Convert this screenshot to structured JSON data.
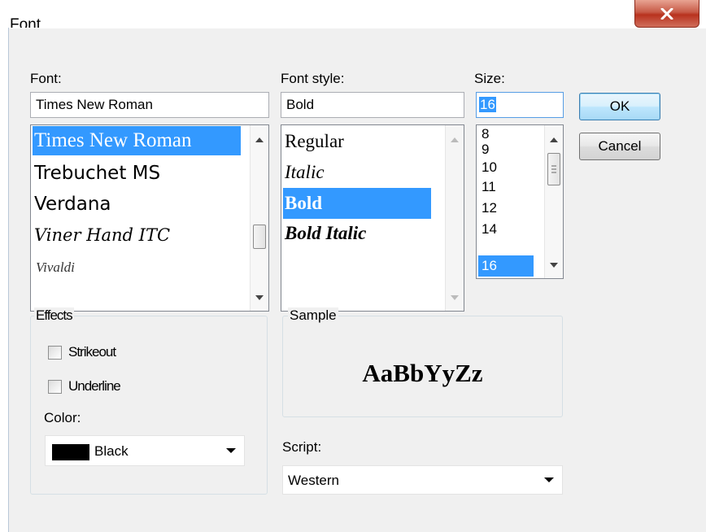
{
  "window": {
    "title": "Font"
  },
  "font": {
    "label": "Font:",
    "value": "Times New Roman",
    "items": [
      {
        "text": "Times New Roman",
        "selected": true
      },
      {
        "text": "Trebuchet MS"
      },
      {
        "text": "Verdana"
      },
      {
        "text": "Viner Hand ITC"
      },
      {
        "text": "Vivaldi"
      }
    ]
  },
  "style": {
    "label": "Font style:",
    "value": "Bold",
    "items": [
      {
        "text": "Regular"
      },
      {
        "text": "Italic"
      },
      {
        "text": "Bold",
        "selected": true
      },
      {
        "text": "Bold Italic"
      }
    ]
  },
  "size": {
    "label": "Size:",
    "value": "16",
    "items": [
      "8",
      "9",
      "10",
      "11",
      "12",
      "14",
      "16"
    ],
    "selected": "16"
  },
  "buttons": {
    "ok": "OK",
    "cancel": "Cancel"
  },
  "effects": {
    "title": "Effects",
    "strikeout": "Strikeout",
    "underline": "Underline",
    "color_label": "Color:",
    "color_value": "Black",
    "color_swatch": "#000000"
  },
  "sample": {
    "title": "Sample",
    "text": "AaBbYyZz"
  },
  "script": {
    "label": "Script:",
    "value": "Western"
  },
  "colors": {
    "selection": "#3399ff",
    "close": "#c75a47"
  }
}
